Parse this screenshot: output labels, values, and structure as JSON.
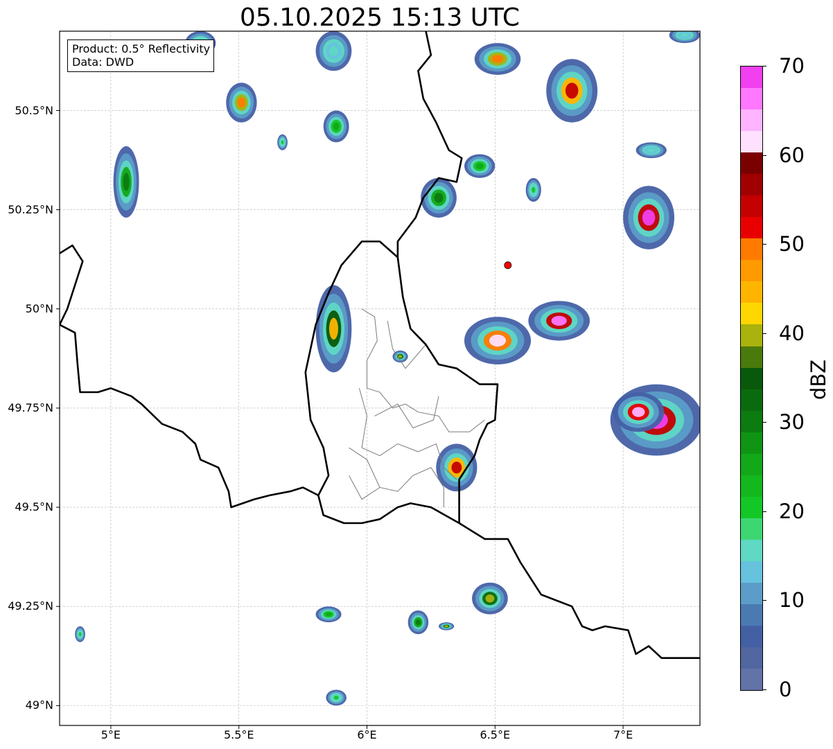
{
  "title": "05.10.2025 15:13 UTC",
  "info": {
    "product": "Product: 0.5° Reflectivity",
    "data": "Data: DWD"
  },
  "map_extent": {
    "lon_min": 4.8,
    "lon_max": 7.3,
    "lat_min": 48.95,
    "lat_max": 50.7
  },
  "lon_ticks": [
    {
      "value": 5.0,
      "label": "5°E"
    },
    {
      "value": 5.5,
      "label": "5.5°E"
    },
    {
      "value": 6.0,
      "label": "6°E"
    },
    {
      "value": 6.5,
      "label": "6.5°E"
    },
    {
      "value": 7.0,
      "label": "7°E"
    }
  ],
  "lat_ticks": [
    {
      "value": 49.0,
      "label": "49°N"
    },
    {
      "value": 49.25,
      "label": "49.25°N"
    },
    {
      "value": 49.5,
      "label": "49.5°N"
    },
    {
      "value": 49.75,
      "label": "49.75°N"
    },
    {
      "value": 50.0,
      "label": "50°N"
    },
    {
      "value": 50.25,
      "label": "50.25°N"
    },
    {
      "value": 50.5,
      "label": "50.5°N"
    }
  ],
  "radar_site": {
    "lon": 6.55,
    "lat": 50.11,
    "color": "#ff0000"
  },
  "colorbar": {
    "label": "dBZ",
    "min": 0,
    "max": 70,
    "ticks": [
      {
        "value": 0,
        "label": "0"
      },
      {
        "value": 10,
        "label": "10"
      },
      {
        "value": 20,
        "label": "20"
      },
      {
        "value": 30,
        "label": "30"
      },
      {
        "value": 40,
        "label": "40"
      },
      {
        "value": 50,
        "label": "50"
      },
      {
        "value": 60,
        "label": "60"
      },
      {
        "value": 70,
        "label": "70"
      }
    ],
    "colors": [
      "#6273a8",
      "#52669f",
      "#4460a5",
      "#4b7ab3",
      "#5b9dc8",
      "#67c2de",
      "#5fd8c4",
      "#3dd672",
      "#13c826",
      "#13b81e",
      "#12a819",
      "#0f9414",
      "#0c7b10",
      "#0a6b0e",
      "#08590b",
      "#4a7a0c",
      "#aab20d",
      "#ffd700",
      "#ffb500",
      "#ff9a00",
      "#ff7a00",
      "#e80000",
      "#c40000",
      "#a00000",
      "#7a0000",
      "#ffe0ff",
      "#ffb4ff",
      "#ff78ff",
      "#f040f0"
    ]
  },
  "echoes": [
    {
      "lon": 5.35,
      "lat": 50.67,
      "rx": 0.06,
      "ry": 0.03,
      "level": 8
    },
    {
      "lon": 5.87,
      "lat": 50.65,
      "rx": 0.07,
      "ry": 0.05,
      "level": 6
    },
    {
      "lon": 5.51,
      "lat": 50.52,
      "rx": 0.06,
      "ry": 0.05,
      "level": 20
    },
    {
      "lon": 5.06,
      "lat": 50.32,
      "rx": 0.05,
      "ry": 0.09,
      "level": 12
    },
    {
      "lon": 5.88,
      "lat": 50.46,
      "rx": 0.05,
      "ry": 0.04,
      "level": 10
    },
    {
      "lon": 5.67,
      "lat": 50.42,
      "rx": 0.02,
      "ry": 0.02,
      "level": 8
    },
    {
      "lon": 6.51,
      "lat": 50.63,
      "rx": 0.09,
      "ry": 0.04,
      "level": 20
    },
    {
      "lon": 6.8,
      "lat": 50.55,
      "rx": 0.1,
      "ry": 0.08,
      "level": 22
    },
    {
      "lon": 7.24,
      "lat": 50.69,
      "rx": 0.06,
      "ry": 0.02,
      "level": 6
    },
    {
      "lon": 6.44,
      "lat": 50.36,
      "rx": 0.06,
      "ry": 0.03,
      "level": 10
    },
    {
      "lon": 6.28,
      "lat": 50.28,
      "rx": 0.07,
      "ry": 0.05,
      "level": 12
    },
    {
      "lon": 6.65,
      "lat": 50.3,
      "rx": 0.03,
      "ry": 0.03,
      "level": 8
    },
    {
      "lon": 7.1,
      "lat": 50.23,
      "rx": 0.1,
      "ry": 0.08,
      "level": 28
    },
    {
      "lon": 7.11,
      "lat": 50.4,
      "rx": 0.06,
      "ry": 0.02,
      "level": 6
    },
    {
      "lon": 5.87,
      "lat": 49.95,
      "rx": 0.07,
      "ry": 0.11,
      "level": 18
    },
    {
      "lon": 6.13,
      "lat": 49.88,
      "rx": 0.03,
      "ry": 0.015,
      "level": 16
    },
    {
      "lon": 6.51,
      "lat": 49.92,
      "rx": 0.13,
      "ry": 0.06,
      "level": 25
    },
    {
      "lon": 6.75,
      "lat": 49.97,
      "rx": 0.12,
      "ry": 0.05,
      "level": 27
    },
    {
      "lon": 7.13,
      "lat": 49.72,
      "rx": 0.18,
      "ry": 0.09,
      "level": 32
    },
    {
      "lon": 7.06,
      "lat": 49.74,
      "rx": 0.1,
      "ry": 0.05,
      "level": 26
    },
    {
      "lon": 6.35,
      "lat": 49.6,
      "rx": 0.08,
      "ry": 0.06,
      "level": 22
    },
    {
      "lon": 6.48,
      "lat": 49.27,
      "rx": 0.07,
      "ry": 0.04,
      "level": 16
    },
    {
      "lon": 5.85,
      "lat": 49.23,
      "rx": 0.05,
      "ry": 0.02,
      "level": 10
    },
    {
      "lon": 6.2,
      "lat": 49.21,
      "rx": 0.04,
      "ry": 0.03,
      "level": 12
    },
    {
      "lon": 6.31,
      "lat": 49.2,
      "rx": 0.03,
      "ry": 0.01,
      "level": 16
    },
    {
      "lon": 4.88,
      "lat": 49.18,
      "rx": 0.02,
      "ry": 0.02,
      "level": 8
    },
    {
      "lon": 5.88,
      "lat": 49.02,
      "rx": 0.04,
      "ry": 0.02,
      "level": 8
    }
  ],
  "borders": [
    [
      [
        4.8,
        50.14
      ],
      [
        4.85,
        50.16
      ],
      [
        4.89,
        50.12
      ],
      [
        4.86,
        50.06
      ],
      [
        4.83,
        50.0
      ],
      [
        4.8,
        49.96
      ]
    ],
    [
      [
        4.8,
        49.96
      ],
      [
        4.86,
        49.94
      ],
      [
        4.87,
        49.86
      ],
      [
        4.88,
        49.79
      ],
      [
        4.95,
        49.79
      ],
      [
        5.0,
        49.8
      ],
      [
        5.08,
        49.78
      ],
      [
        5.12,
        49.76
      ],
      [
        5.2,
        49.71
      ],
      [
        5.28,
        49.69
      ],
      [
        5.33,
        49.66
      ],
      [
        5.35,
        49.62
      ],
      [
        5.42,
        49.6
      ],
      [
        5.46,
        49.54
      ],
      [
        5.47,
        49.5
      ],
      [
        5.56,
        49.52
      ],
      [
        5.62,
        49.53
      ],
      [
        5.7,
        49.54
      ],
      [
        5.75,
        49.55
      ],
      [
        5.81,
        49.53
      ],
      [
        5.83,
        49.48
      ],
      [
        5.91,
        49.46
      ],
      [
        5.98,
        49.46
      ],
      [
        6.05,
        49.47
      ],
      [
        6.12,
        49.5
      ],
      [
        6.17,
        49.51
      ],
      [
        6.25,
        49.5
      ],
      [
        6.36,
        49.46
      ]
    ],
    [
      [
        6.36,
        49.46
      ],
      [
        6.36,
        49.57
      ],
      [
        6.42,
        49.63
      ],
      [
        6.44,
        49.67
      ],
      [
        6.47,
        49.71
      ],
      [
        6.5,
        49.72
      ],
      [
        6.51,
        49.81
      ],
      [
        6.44,
        49.81
      ],
      [
        6.35,
        49.85
      ],
      [
        6.28,
        49.86
      ],
      [
        6.23,
        49.91
      ],
      [
        6.17,
        49.95
      ],
      [
        6.14,
        50.03
      ],
      [
        6.12,
        50.13
      ],
      [
        6.05,
        50.17
      ],
      [
        5.98,
        50.17
      ],
      [
        5.9,
        50.11
      ],
      [
        5.85,
        50.04
      ],
      [
        5.8,
        49.96
      ],
      [
        5.76,
        49.84
      ],
      [
        5.78,
        49.72
      ],
      [
        5.83,
        49.65
      ],
      [
        5.85,
        49.58
      ],
      [
        5.81,
        49.53
      ]
    ],
    [
      [
        6.12,
        50.13
      ],
      [
        6.12,
        50.17
      ],
      [
        6.19,
        50.23
      ],
      [
        6.22,
        50.28
      ],
      [
        6.28,
        50.33
      ],
      [
        6.35,
        50.32
      ],
      [
        6.37,
        50.38
      ],
      [
        6.32,
        50.4
      ],
      [
        6.27,
        50.47
      ],
      [
        6.22,
        50.53
      ],
      [
        6.2,
        50.6
      ],
      [
        6.25,
        50.64
      ],
      [
        6.23,
        50.7
      ]
    ],
    [
      [
        6.36,
        49.46
      ],
      [
        6.46,
        49.42
      ],
      [
        6.55,
        49.42
      ],
      [
        6.6,
        49.36
      ],
      [
        6.68,
        49.28
      ],
      [
        6.8,
        49.25
      ],
      [
        6.84,
        49.2
      ],
      [
        6.88,
        49.19
      ],
      [
        6.93,
        49.2
      ],
      [
        7.02,
        49.19
      ],
      [
        7.05,
        49.13
      ],
      [
        7.1,
        49.15
      ],
      [
        7.15,
        49.12
      ],
      [
        7.2,
        49.12
      ],
      [
        7.3,
        49.12
      ]
    ]
  ],
  "internal_borders": [
    [
      [
        5.98,
        50.0
      ],
      [
        6.03,
        49.98
      ],
      [
        6.04,
        49.92
      ],
      [
        6.0,
        49.87
      ],
      [
        6.0,
        49.8
      ],
      [
        6.05,
        49.79
      ],
      [
        6.1,
        49.75
      ],
      [
        6.15,
        49.76
      ],
      [
        6.2,
        49.74
      ],
      [
        6.28,
        49.73
      ],
      [
        6.32,
        49.69
      ],
      [
        6.4,
        49.69
      ],
      [
        6.46,
        49.72
      ]
    ],
    [
      [
        6.08,
        49.97
      ],
      [
        6.1,
        49.9
      ],
      [
        6.15,
        49.85
      ],
      [
        6.23,
        49.91
      ]
    ],
    [
      [
        5.97,
        49.8
      ],
      [
        6.0,
        49.73
      ],
      [
        5.98,
        49.65
      ],
      [
        6.05,
        49.63
      ],
      [
        6.12,
        49.66
      ],
      [
        6.2,
        49.64
      ],
      [
        6.27,
        49.66
      ],
      [
        6.3,
        49.6
      ],
      [
        6.35,
        49.57
      ]
    ],
    [
      [
        6.03,
        49.73
      ],
      [
        6.12,
        49.76
      ],
      [
        6.18,
        49.7
      ],
      [
        6.26,
        49.72
      ],
      [
        6.28,
        49.78
      ]
    ],
    [
      [
        5.93,
        49.65
      ],
      [
        6.0,
        49.62
      ],
      [
        6.05,
        49.55
      ],
      [
        6.12,
        49.54
      ],
      [
        6.18,
        49.58
      ],
      [
        6.25,
        49.6
      ],
      [
        6.3,
        49.55
      ],
      [
        6.3,
        49.5
      ]
    ],
    [
      [
        6.05,
        49.55
      ],
      [
        5.98,
        49.52
      ],
      [
        5.93,
        49.58
      ]
    ]
  ]
}
